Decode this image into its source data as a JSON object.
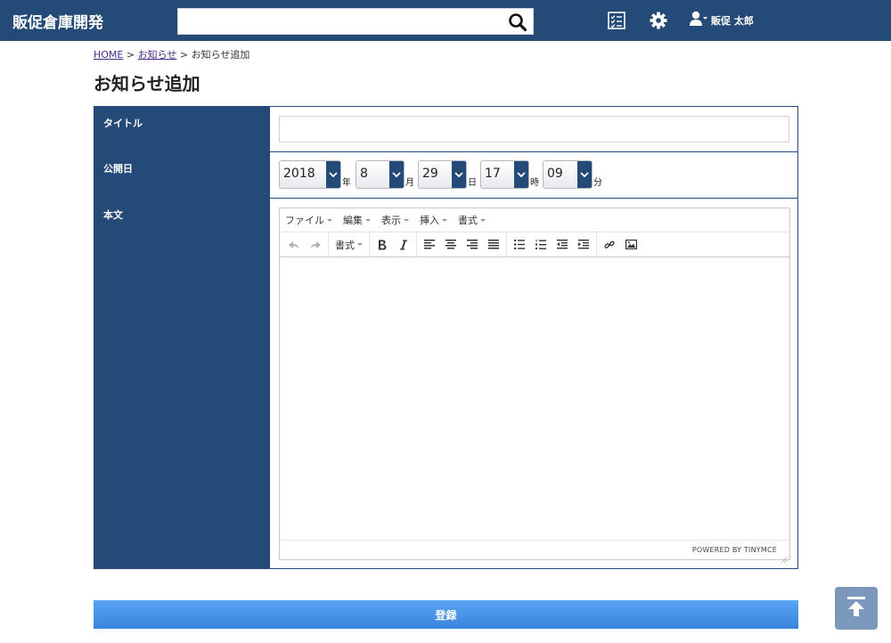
{
  "header": {
    "brand": "販促倉庫開発",
    "search_placeholder": "",
    "user_name": "販促 太郎"
  },
  "breadcrumb": {
    "home": "HOME",
    "sep1": ">",
    "news": "お知らせ",
    "sep2": ">",
    "current": "お知らせ追加"
  },
  "page_title": "お知らせ追加",
  "form": {
    "title_label": "タイトル",
    "title_value": "",
    "date_label": "公開日",
    "year": "2018",
    "year_unit": "年",
    "month": "8",
    "month_unit": "月",
    "day": "29",
    "day_unit": "日",
    "hour": "17",
    "hour_unit": "時",
    "minute": "09",
    "minute_unit": "分",
    "body_label": "本文"
  },
  "editor": {
    "menus": [
      "ファイル",
      "編集",
      "表示",
      "挿入",
      "書式"
    ],
    "format_dropdown": "書式",
    "powered_by": "POWERED BY TINYMCE"
  },
  "submit_label": "登録",
  "colors": {
    "header_bg": "#244a78",
    "label_bg": "#244a78",
    "submit_bg": "#4a94ea",
    "scroll_top_bg": "#7c98bd"
  }
}
